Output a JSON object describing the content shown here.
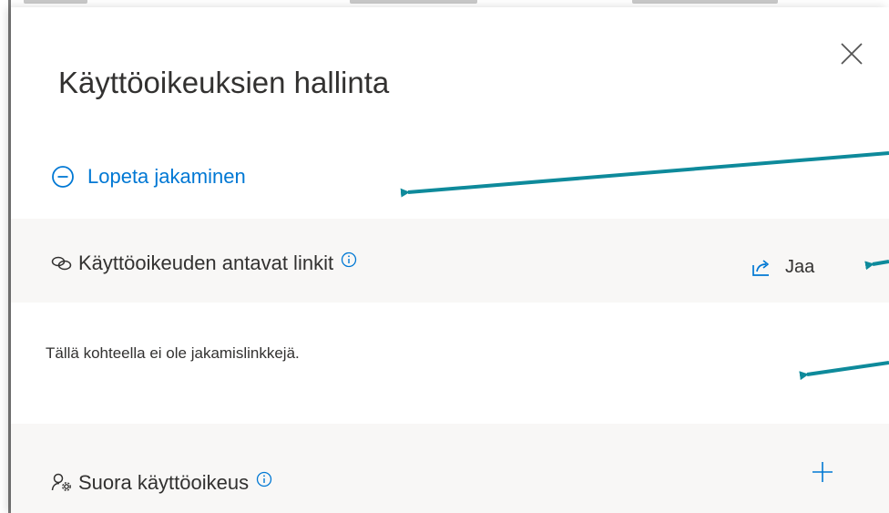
{
  "panel": {
    "title": "Käyttöoikeuksien hallinta",
    "close_icon": "close-icon",
    "stop_sharing": {
      "label": "Lopeta jakaminen",
      "icon": "minus-circle-icon"
    }
  },
  "links_section": {
    "title": "Käyttöoikeuden antavat linkit",
    "icon": "link-icon",
    "info_icon": "info-icon",
    "share_button": {
      "label": "Jaa",
      "icon": "share-icon"
    },
    "empty_message": "Tällä kohteella ei ole jakamislinkkejä."
  },
  "direct_section": {
    "title": "Suora käyttöoikeus",
    "icon": "person-settings-icon",
    "info_icon": "info-icon",
    "add_icon": "plus-icon"
  },
  "colors": {
    "accent": "#0078d4",
    "text": "#323130",
    "section_bg": "#f8f7f6",
    "annotation_arrow": "#0e8a9b"
  }
}
